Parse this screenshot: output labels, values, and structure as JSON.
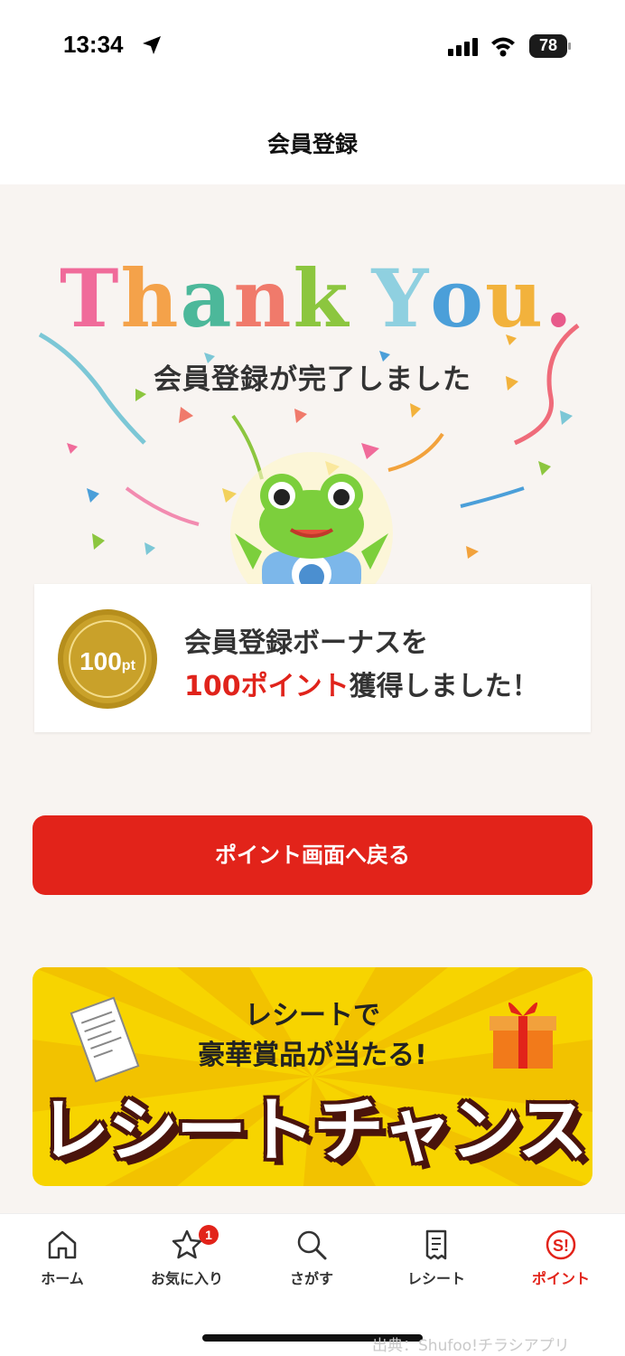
{
  "status_bar": {
    "time": "13:34",
    "battery": "78"
  },
  "header": {
    "title": "会員登録"
  },
  "hero": {
    "thank_you": [
      "T",
      "h",
      "a",
      "n",
      "k",
      " ",
      "Y",
      "o",
      "u",
      "."
    ],
    "thank_you_colors": [
      "#f06b9a",
      "#f4a24a",
      "#4cb89a",
      "#f07a6b",
      "#8cc63f",
      "#ffffff",
      "#8fd0e0",
      "#4b9fd9",
      "#f2b23c",
      "#e85a8a"
    ],
    "complete_message": "会員登録が完了しました"
  },
  "bonus": {
    "coin_value": "100",
    "coin_unit": "pt",
    "line1": "会員登録ボーナスを",
    "line2_red": "100ポイント",
    "line2_rest": "獲得しました！"
  },
  "cta": {
    "label": "ポイント画面へ戻る"
  },
  "banner": {
    "sub1": "レシートで",
    "sub2": "豪華賞品が当たる!",
    "title": "レシートチャンス"
  },
  "tabbar": {
    "items": [
      {
        "label": "ホーム",
        "icon": "home-icon"
      },
      {
        "label": "お気に入り",
        "icon": "star-icon",
        "badge": "1"
      },
      {
        "label": "さがす",
        "icon": "search-icon"
      },
      {
        "label": "レシート",
        "icon": "receipt-icon"
      },
      {
        "label": "ポイント",
        "icon": "points-icon",
        "active": true
      }
    ]
  },
  "watermark": "出典：Shufoo!チラシアプリ",
  "colors": {
    "accent": "#e2231a",
    "background": "#f8f4f1",
    "banner": "#f7d400",
    "coin": "#c9a12a"
  }
}
